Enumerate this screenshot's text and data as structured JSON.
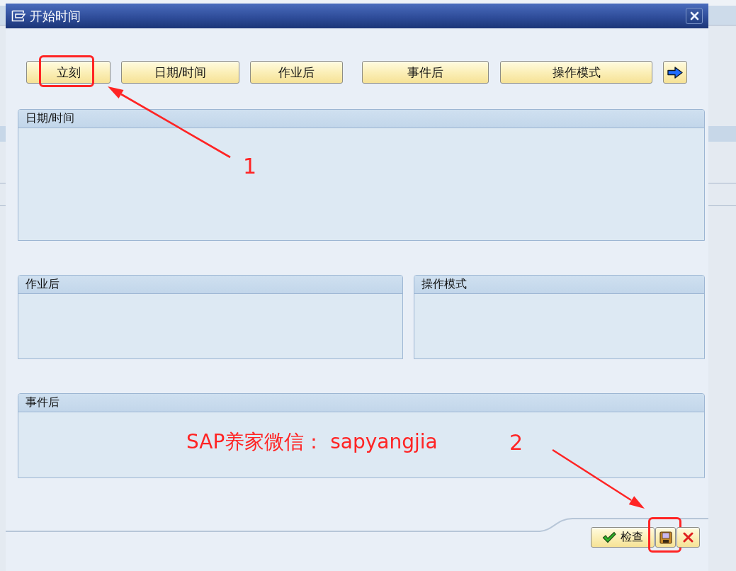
{
  "window": {
    "title": "开始时间"
  },
  "toolbar": {
    "buttons": [
      {
        "kind": "text",
        "label": "立刻",
        "highlighted": true
      },
      {
        "kind": "text",
        "label": "日期/时间",
        "highlighted": false
      },
      {
        "kind": "text",
        "label": "作业后",
        "highlighted": false
      },
      {
        "kind": "text",
        "label": "事件后",
        "highlighted": false
      },
      {
        "kind": "text",
        "label": "操作模式",
        "highlighted": false
      },
      {
        "kind": "arrow",
        "highlighted": false
      }
    ]
  },
  "group_rows": [
    [
      {
        "title": "日期/时间"
      }
    ],
    [
      {
        "title": "作业后"
      },
      {
        "title": "操作模式"
      }
    ],
    [
      {
        "title": "事件后"
      }
    ]
  ],
  "footer": {
    "buttons": [
      {
        "kind": "check",
        "label": "检查",
        "highlighted": false
      },
      {
        "kind": "save",
        "highlighted": true
      },
      {
        "kind": "cancel",
        "highlighted": false
      }
    ]
  },
  "annotations": {
    "callouts": [
      {
        "number": "1"
      },
      {
        "number": "2"
      }
    ],
    "note": "SAP养家微信： sapyangjia"
  }
}
